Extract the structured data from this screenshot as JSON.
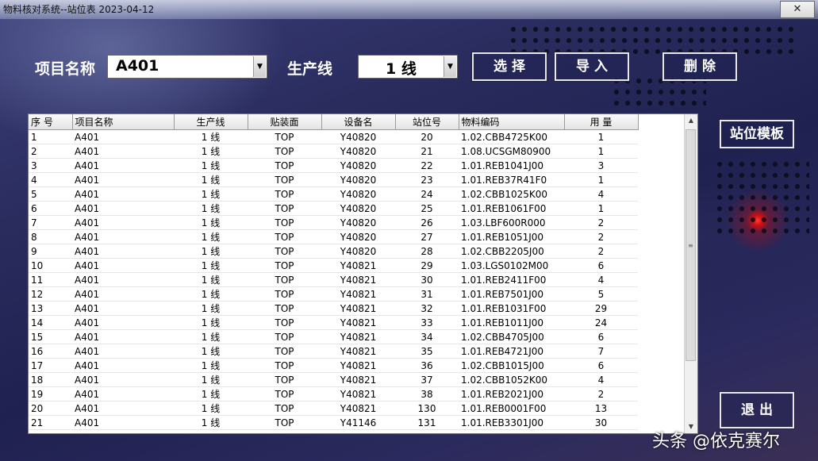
{
  "window": {
    "title": "物料核对系统--站位表  2023-04-12",
    "close_label": "✕"
  },
  "form": {
    "project_label": "项目名称",
    "project_value": "A401",
    "line_label": "生产线",
    "line_value": "1  线"
  },
  "buttons": {
    "select": "选 择",
    "import": "导 入",
    "delete": "删 除",
    "template": "站位模板",
    "exit": "退 出"
  },
  "table": {
    "headers": [
      "序 号",
      "项目名称",
      "生产线",
      "贴装面",
      "设备名",
      "站位号",
      "物料编码",
      "用 量"
    ],
    "rows": [
      [
        "1",
        "A401",
        "1 线",
        "TOP",
        "Y40820",
        "20",
        "1.02.CBB4725K00",
        "1"
      ],
      [
        "2",
        "A401",
        "1 线",
        "TOP",
        "Y40820",
        "21",
        "1.08.UCSGM80900",
        "1"
      ],
      [
        "3",
        "A401",
        "1 线",
        "TOP",
        "Y40820",
        "22",
        "1.01.REB1041J00",
        "3"
      ],
      [
        "4",
        "A401",
        "1 线",
        "TOP",
        "Y40820",
        "23",
        "1.01.REB37R41F0",
        "1"
      ],
      [
        "5",
        "A401",
        "1 线",
        "TOP",
        "Y40820",
        "24",
        "1.02.CBB1025K00",
        "4"
      ],
      [
        "6",
        "A401",
        "1 线",
        "TOP",
        "Y40820",
        "25",
        "1.01.REB1061F00",
        "1"
      ],
      [
        "7",
        "A401",
        "1 线",
        "TOP",
        "Y40820",
        "26",
        "1.03.LBF600R000",
        "2"
      ],
      [
        "8",
        "A401",
        "1 线",
        "TOP",
        "Y40820",
        "27",
        "1.01.REB1051J00",
        "2"
      ],
      [
        "9",
        "A401",
        "1 线",
        "TOP",
        "Y40820",
        "28",
        "1.02.CBB2205J00",
        "2"
      ],
      [
        "10",
        "A401",
        "1 线",
        "TOP",
        "Y40821",
        "29",
        "1.03.LGS0102M00",
        "6"
      ],
      [
        "11",
        "A401",
        "1 线",
        "TOP",
        "Y40821",
        "30",
        "1.01.REB2411F00",
        "4"
      ],
      [
        "12",
        "A401",
        "1 线",
        "TOP",
        "Y40821",
        "31",
        "1.01.REB7501J00",
        "5"
      ],
      [
        "13",
        "A401",
        "1 线",
        "TOP",
        "Y40821",
        "32",
        "1.01.REB1031F00",
        "29"
      ],
      [
        "14",
        "A401",
        "1 线",
        "TOP",
        "Y40821",
        "33",
        "1.01.REB1011J00",
        "24"
      ],
      [
        "15",
        "A401",
        "1 线",
        "TOP",
        "Y40821",
        "34",
        "1.02.CBB4705J00",
        "6"
      ],
      [
        "16",
        "A401",
        "1 线",
        "TOP",
        "Y40821",
        "35",
        "1.01.REB4721J00",
        "7"
      ],
      [
        "17",
        "A401",
        "1 线",
        "TOP",
        "Y40821",
        "36",
        "1.02.CBB1015J00",
        "6"
      ],
      [
        "18",
        "A401",
        "1 线",
        "TOP",
        "Y40821",
        "37",
        "1.02.CBB1052K00",
        "4"
      ],
      [
        "19",
        "A401",
        "1 线",
        "TOP",
        "Y40821",
        "38",
        "1.01.REB2021J00",
        "2"
      ],
      [
        "20",
        "A401",
        "1 线",
        "TOP",
        "Y40821",
        "130",
        "1.01.REB0001F00",
        "13"
      ],
      [
        "21",
        "A401",
        "1 线",
        "TOP",
        "Y41146",
        "131",
        "1.01.REB3301J00",
        "30"
      ]
    ]
  },
  "watermark": "头条 @依克赛尔",
  "icons": {
    "dropdown": "chevron-down-icon",
    "scroll_up": "scroll-up-icon",
    "scroll_down": "scroll-down-icon"
  }
}
